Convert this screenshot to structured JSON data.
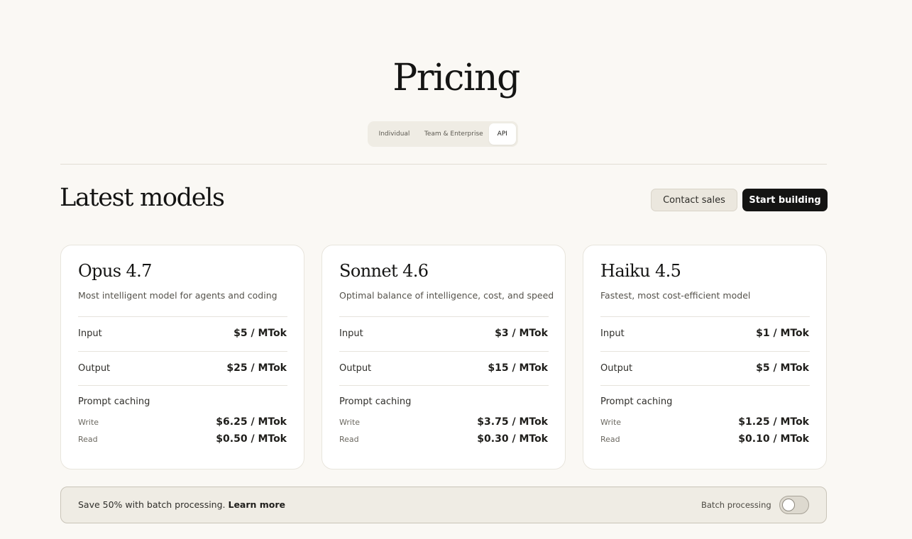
{
  "page": {
    "title": "Pricing"
  },
  "plan_tabs": {
    "items": [
      {
        "label": "Individual",
        "selected": false
      },
      {
        "label": "Team & Enterprise",
        "selected": false
      },
      {
        "label": "API",
        "selected": true
      }
    ]
  },
  "section": {
    "title": "Latest models",
    "contact_label": "Contact sales",
    "start_label": "Start building"
  },
  "models": [
    {
      "name": "Opus 4.7",
      "description": "Most intelligent model for agents and coding",
      "input_label": "Input",
      "input_price": "$5 / MTok",
      "output_label": "Output",
      "output_price": "$25 / MTok",
      "caching_label": "Prompt caching",
      "write_label": "Write",
      "write_price": "$6.25 / MTok",
      "read_label": "Read",
      "read_price": "$0.50 / MTok"
    },
    {
      "name": "Sonnet 4.6",
      "description": "Optimal balance of intelligence, cost, and speed",
      "input_label": "Input",
      "input_price": "$3 / MTok",
      "output_label": "Output",
      "output_price": "$15 / MTok",
      "caching_label": "Prompt caching",
      "write_label": "Write",
      "write_price": "$3.75 / MTok",
      "read_label": "Read",
      "read_price": "$0.30 / MTok"
    },
    {
      "name": "Haiku 4.5",
      "description": "Fastest, most cost-efficient model",
      "input_label": "Input",
      "input_price": "$1 / MTok",
      "output_label": "Output",
      "output_price": "$5 / MTok",
      "caching_label": "Prompt caching",
      "write_label": "Write",
      "write_price": "$1.25 / MTok",
      "read_label": "Read",
      "read_price": "$0.10 / MTok"
    }
  ],
  "batch": {
    "text": "Save 50% with batch processing. ",
    "link_label": "Learn more",
    "toggle_label": "Batch processing",
    "toggle_on": false
  },
  "colors": {
    "background": "#faf8f4",
    "primary_button": "#141413",
    "card": "#ffffff"
  }
}
